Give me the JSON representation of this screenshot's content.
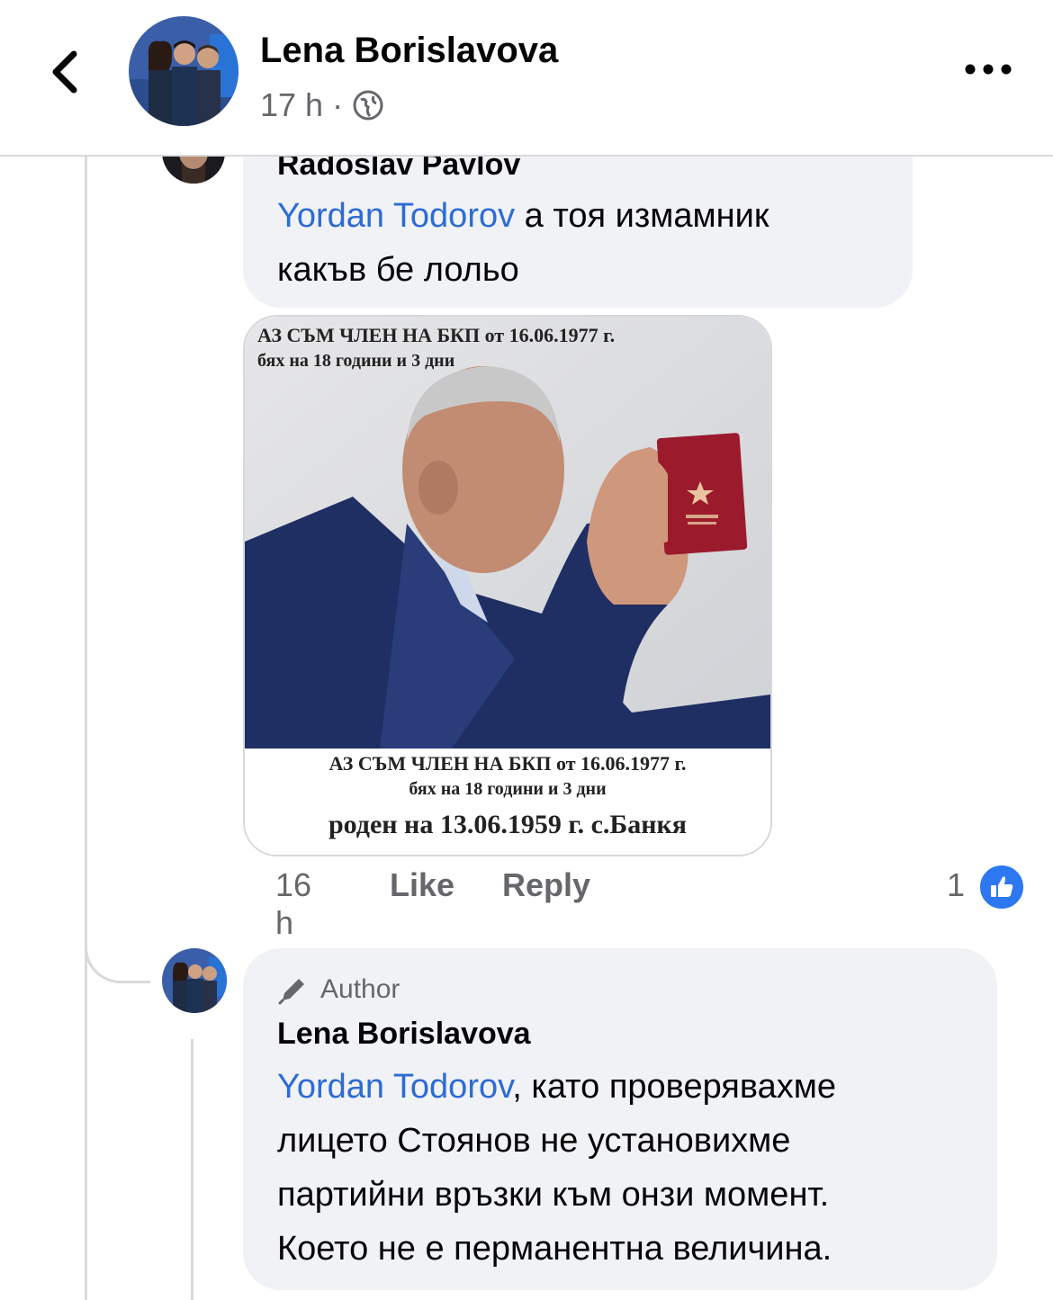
{
  "header": {
    "name": "Lena Borislavova",
    "time": "17 h",
    "separator": "·"
  },
  "comment1": {
    "author": "Radoslav Pavlov",
    "mention": "Yordan Todorov",
    "text_line1": " а тоя измамник",
    "text_line2": "какъв бе лольо",
    "image": {
      "top_line1": "АЗ СЪМ ЧЛЕН НА БКП от 16.06.1977 г.",
      "top_line2": "бях на 18 години и 3 дни",
      "bottom_line1": "АЗ СЪМ ЧЛЕН НА БКП от 16.06.1977 г.",
      "bottom_line2": "бях на 18 години и 3 дни",
      "bottom_line3": "роден на 13.06.1959 г. с.Банкя"
    },
    "time": "16 h",
    "like_label": "Like",
    "reply_label": "Reply",
    "like_count": "1"
  },
  "comment2": {
    "badge": "Author",
    "author": "Lena Borislavova",
    "mention": "Yordan Todorov",
    "line1_rest": ", като проверявахме",
    "line2": "лицето Стоянов не установихме",
    "line3": "партийни връзки към онзи момент.",
    "line4": "Което не е перманентна величина."
  },
  "colors": {
    "mention": "#2d6bd6",
    "bubble": "#f0f2f5",
    "like_badge": "#2d78f0",
    "meta": "#65676b"
  }
}
